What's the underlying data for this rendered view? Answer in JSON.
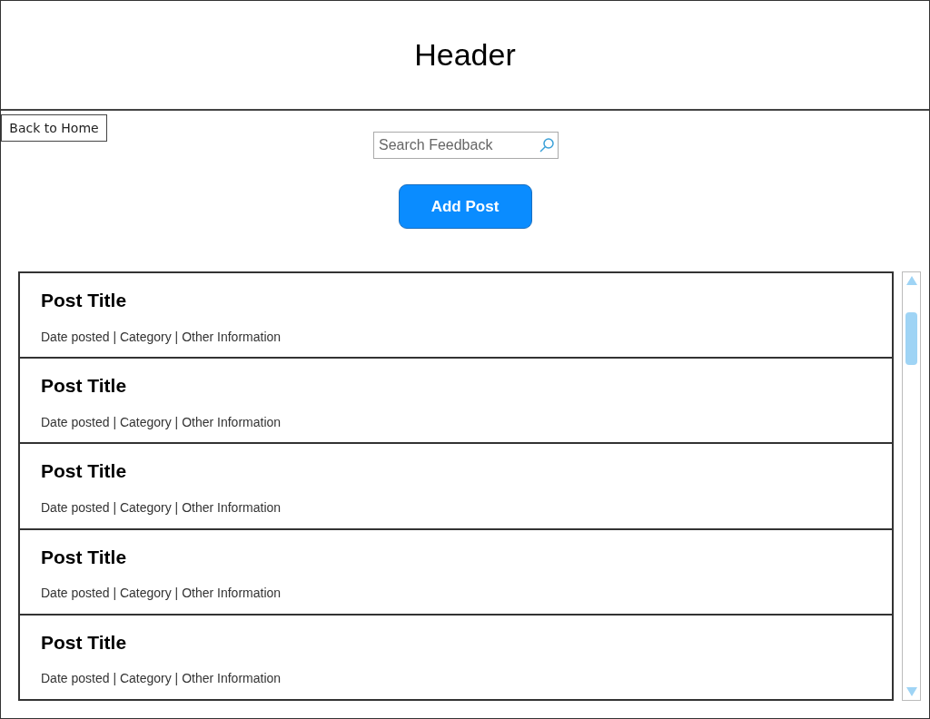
{
  "header": {
    "title": "Header"
  },
  "back_button": {
    "label": "Back to Home"
  },
  "search": {
    "placeholder": "Search Feedback"
  },
  "add_button": {
    "label": "Add Post"
  },
  "posts": [
    {
      "title": "Post Title",
      "meta": "Date posted | Category | Other Information"
    },
    {
      "title": "Post Title",
      "meta": "Date posted | Category | Other Information"
    },
    {
      "title": "Post Title",
      "meta": "Date posted | Category | Other Information"
    },
    {
      "title": "Post Title",
      "meta": "Date posted | Category | Other Information"
    },
    {
      "title": "Post Title",
      "meta": "Date posted | Category | Other Information"
    }
  ]
}
